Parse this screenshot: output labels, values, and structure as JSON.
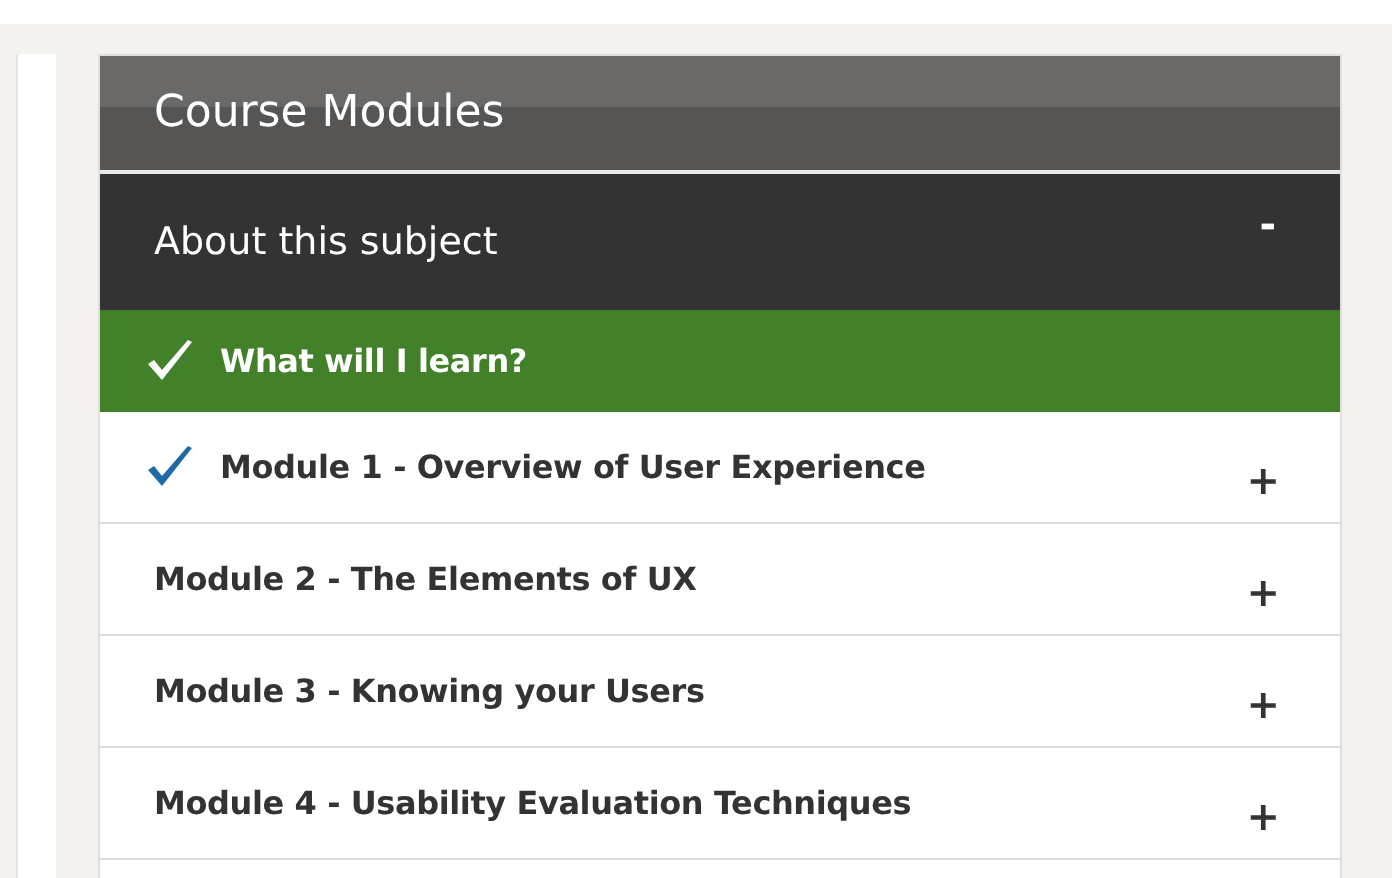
{
  "panel": {
    "title": "Course Modules"
  },
  "section": {
    "label": "About this subject",
    "toggle": "-",
    "expanded": true
  },
  "items": [
    {
      "label": "What will I learn?",
      "selected": true,
      "checked": true
    },
    {
      "label": "Module 1 - Overview of User Experience",
      "selected": false,
      "checked": true,
      "toggle": "+"
    },
    {
      "label": "Module 2 - The Elements of UX",
      "selected": false,
      "checked": false,
      "toggle": "+"
    },
    {
      "label": "Module 3 - Knowing your Users",
      "selected": false,
      "checked": false,
      "toggle": "+"
    },
    {
      "label": "Module 4 - Usability Evaluation Techniques",
      "selected": false,
      "checked": false,
      "toggle": "+"
    }
  ]
}
